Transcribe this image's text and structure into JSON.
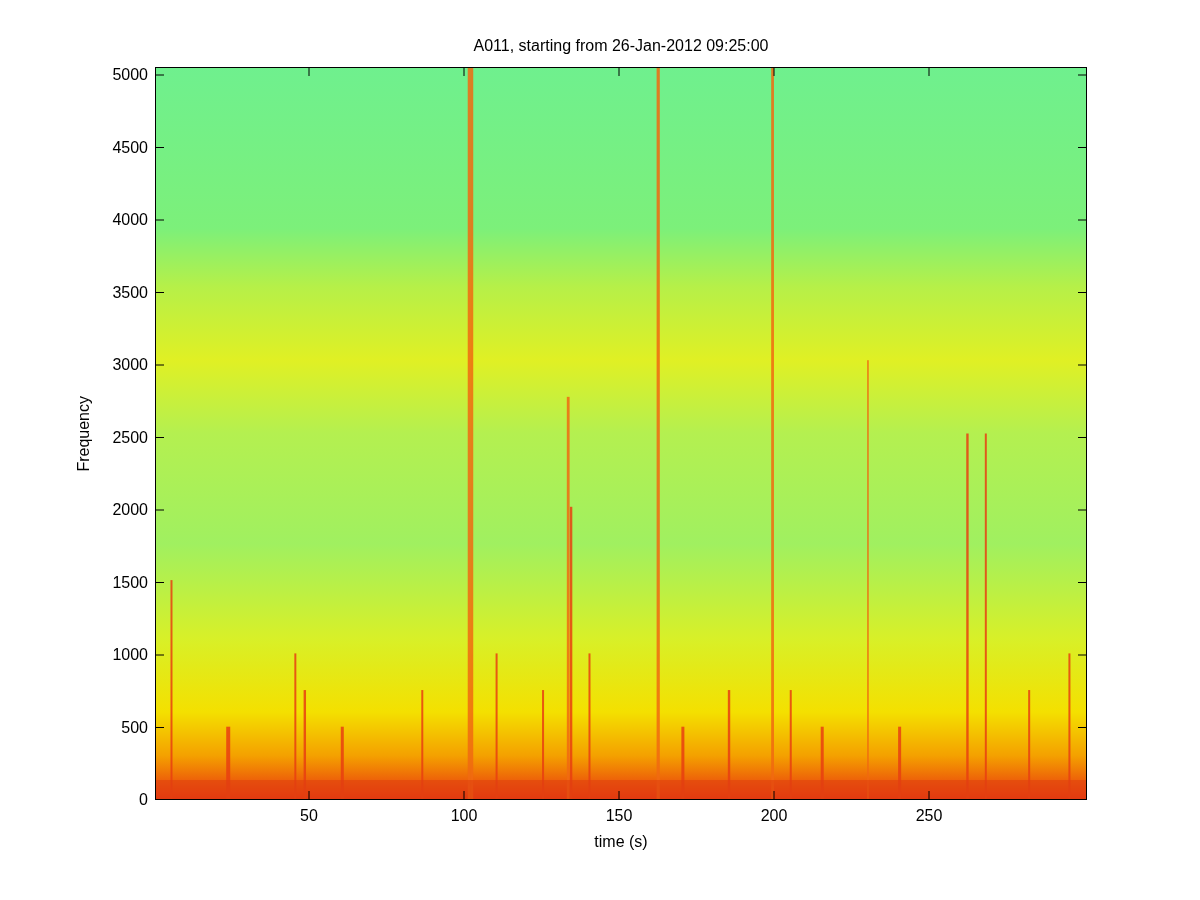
{
  "figure": {
    "title": "A011, starting from 26-Jan-2012 09:25:00",
    "ylabel": "Frequency",
    "xlabel": "time (s)",
    "yticks": [
      "5000",
      "4500",
      "4000",
      "3500",
      "3000",
      "2500",
      "2000",
      "1500",
      "1000",
      "500",
      "0"
    ],
    "xticks": [
      "50",
      "100",
      "150",
      "200",
      "250"
    ]
  }
}
